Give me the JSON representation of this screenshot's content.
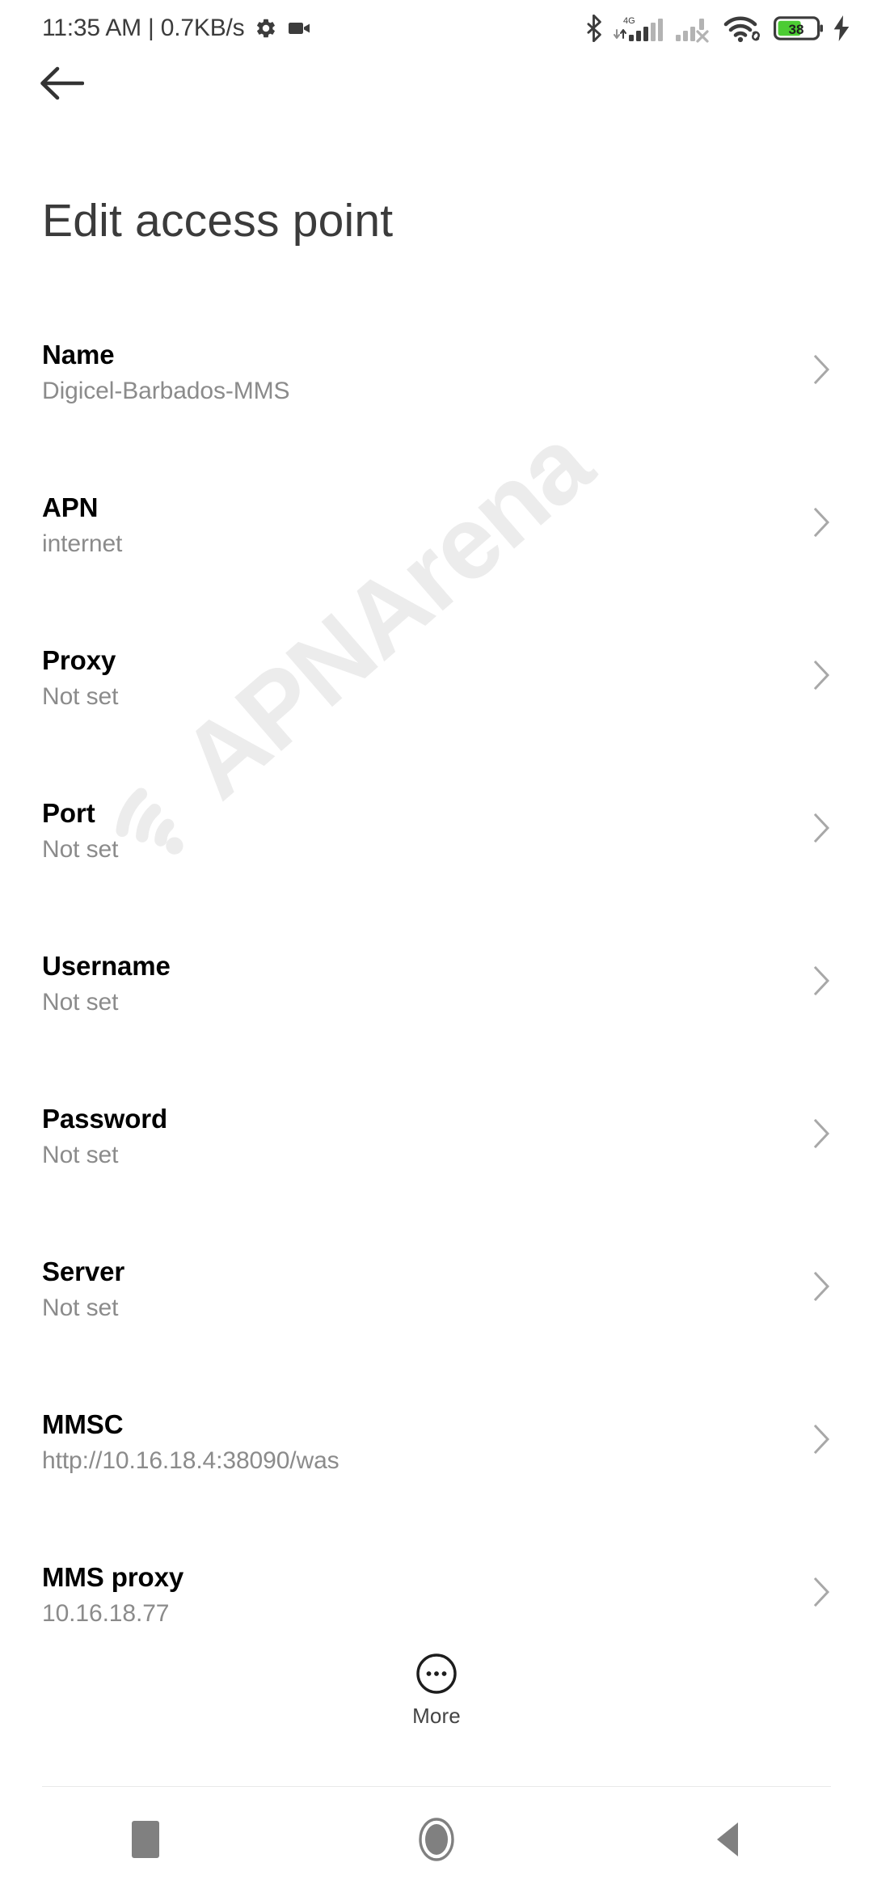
{
  "status_bar": {
    "clock_text": "11:35 AM | 0.7KB/s",
    "gear_icon": "gear-icon",
    "video_icon": "video-camera-icon",
    "bluetooth_icon": "bluetooth-icon",
    "network_type": "4G",
    "sim1_icon": "signal-sim1-icon",
    "sim2_icon": "signal-sim2-no-service-icon",
    "wifi_icon": "wifi-icon",
    "vpn_icon": "vpn-link-icon",
    "battery_level": "38",
    "battery_icon": "battery-icon",
    "charging_icon": "charging-bolt-icon",
    "battery_fill_color": "#4ccc33"
  },
  "header": {
    "back_icon": "back-arrow-icon",
    "title": "Edit access point"
  },
  "list": {
    "chevron_icon": "chevron-right-icon",
    "rows": [
      {
        "title": "Name",
        "value": "Digicel-Barbados-MMS"
      },
      {
        "title": "APN",
        "value": "internet"
      },
      {
        "title": "Proxy",
        "value": "Not set"
      },
      {
        "title": "Port",
        "value": "Not set"
      },
      {
        "title": "Username",
        "value": "Not set"
      },
      {
        "title": "Password",
        "value": "Not set"
      },
      {
        "title": "Server",
        "value": "Not set"
      },
      {
        "title": "MMSC",
        "value": "http://10.16.18.4:38090/was"
      },
      {
        "title": "MMS proxy",
        "value": "10.16.18.77"
      }
    ]
  },
  "more_button": {
    "label": "More",
    "icon": "more-dots-circle-icon"
  },
  "watermark": {
    "text": "APNArena",
    "logo_icon": "wifi-arcs-logo-icon",
    "color": "#ececec"
  },
  "nav_bar": {
    "recents_icon": "recents-square-icon",
    "home_icon": "home-circle-icon",
    "back_icon": "back-triangle-icon"
  }
}
